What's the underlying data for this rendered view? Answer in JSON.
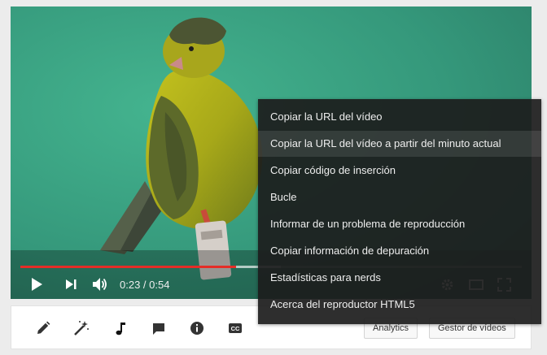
{
  "player": {
    "time_display": "0:23 / 0:54",
    "progress_played": 0.43,
    "progress_loaded": 0.52,
    "accent_color": "#e52d27",
    "controls": {
      "play": "play-icon",
      "next": "next-icon",
      "volume": "volume-icon",
      "settings": "gear-icon",
      "theater": "theater-mode-icon",
      "fullscreen": "fullscreen-icon"
    }
  },
  "context_menu": {
    "items": [
      "Copiar la URL del vídeo",
      "Copiar la URL del vídeo a partir del minuto actual",
      "Copiar código de inserción",
      "Bucle",
      "Informar de un problema de reproducción",
      "Copiar información de depuración",
      "Estadísticas para nerds",
      "Acerca del reproductor HTML5"
    ],
    "highlighted_index": 1
  },
  "toolbar": {
    "tools": [
      "pencil-icon",
      "magic-wand-icon",
      "music-note-icon",
      "comment-icon",
      "info-icon",
      "captions-icon"
    ],
    "analytics_label": "Analytics",
    "video_manager_label": "Gestor de vídeos"
  }
}
